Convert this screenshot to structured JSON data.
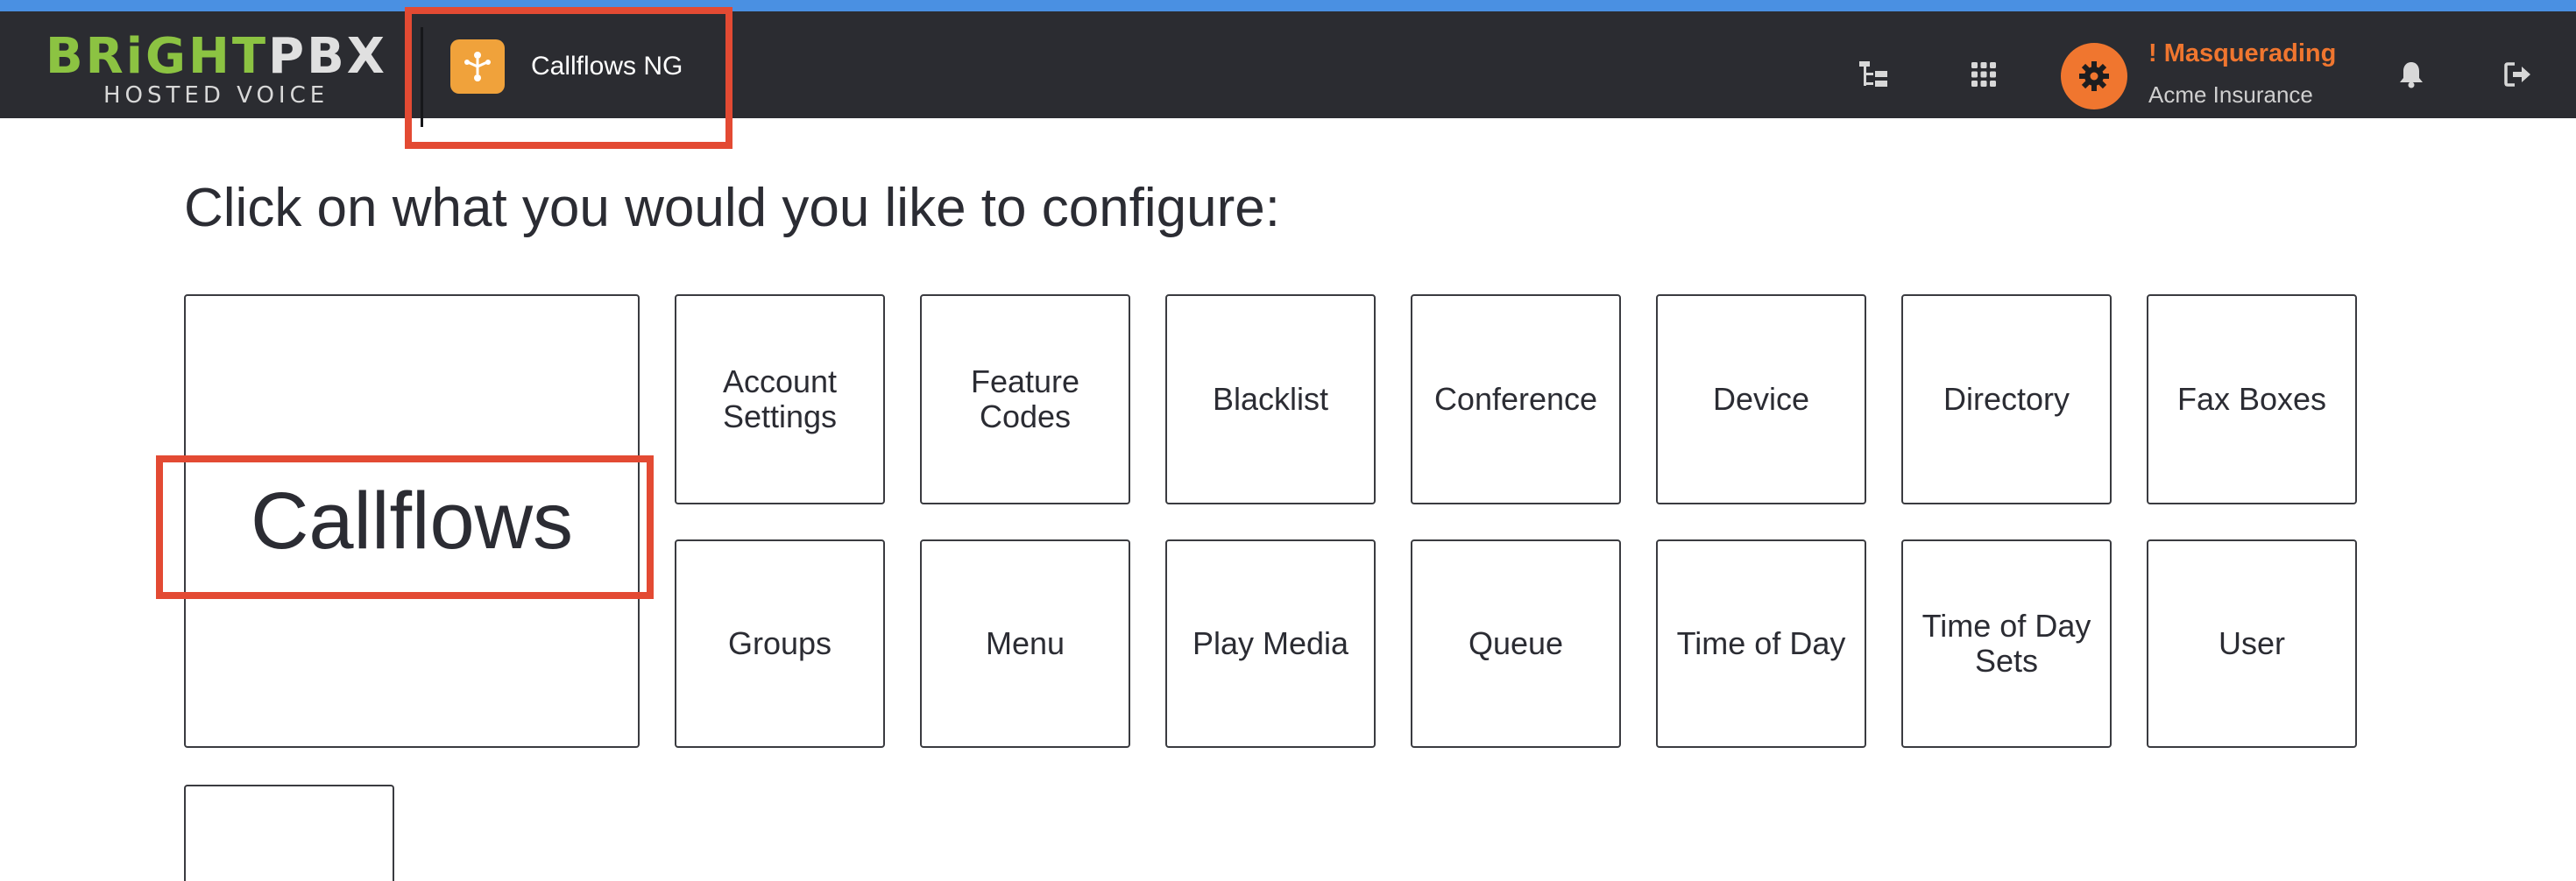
{
  "header": {
    "logo": {
      "brand_bright": "BRiGHT",
      "brand_pbx": "PBX",
      "tagline": "HOSTED VOICE"
    },
    "app": {
      "icon": "callflow-icon",
      "title": "Callflows NG"
    },
    "icons": [
      "tree-view-icon",
      "app-grid-icon",
      "bell-icon",
      "logout-icon"
    ],
    "user": {
      "status": "! Masquerading",
      "account": "Acme Insurance",
      "avatar_icon": "gear-icon"
    }
  },
  "main": {
    "title": "Click on what you would you like to configure:",
    "primary_tile": "Callflows",
    "tiles_row1": [
      "Account Settings",
      "Feature Codes",
      "Blacklist",
      "Conference",
      "Device",
      "Directory",
      "Fax Boxes"
    ],
    "tiles_row2": [
      "Groups",
      "Menu",
      "Play Media",
      "Queue",
      "Time of Day",
      "Time of Day Sets",
      "User"
    ],
    "tile_row3_partial": ""
  },
  "colors": {
    "accent_bar": "#4a90e2",
    "topbar_bg": "#2b2c31",
    "brand_green": "#8cc342",
    "app_icon_bg": "#f0a23b",
    "avatar_bg": "#f0762f",
    "masquerade_text": "#f0762f",
    "highlight": "#e34a33"
  }
}
